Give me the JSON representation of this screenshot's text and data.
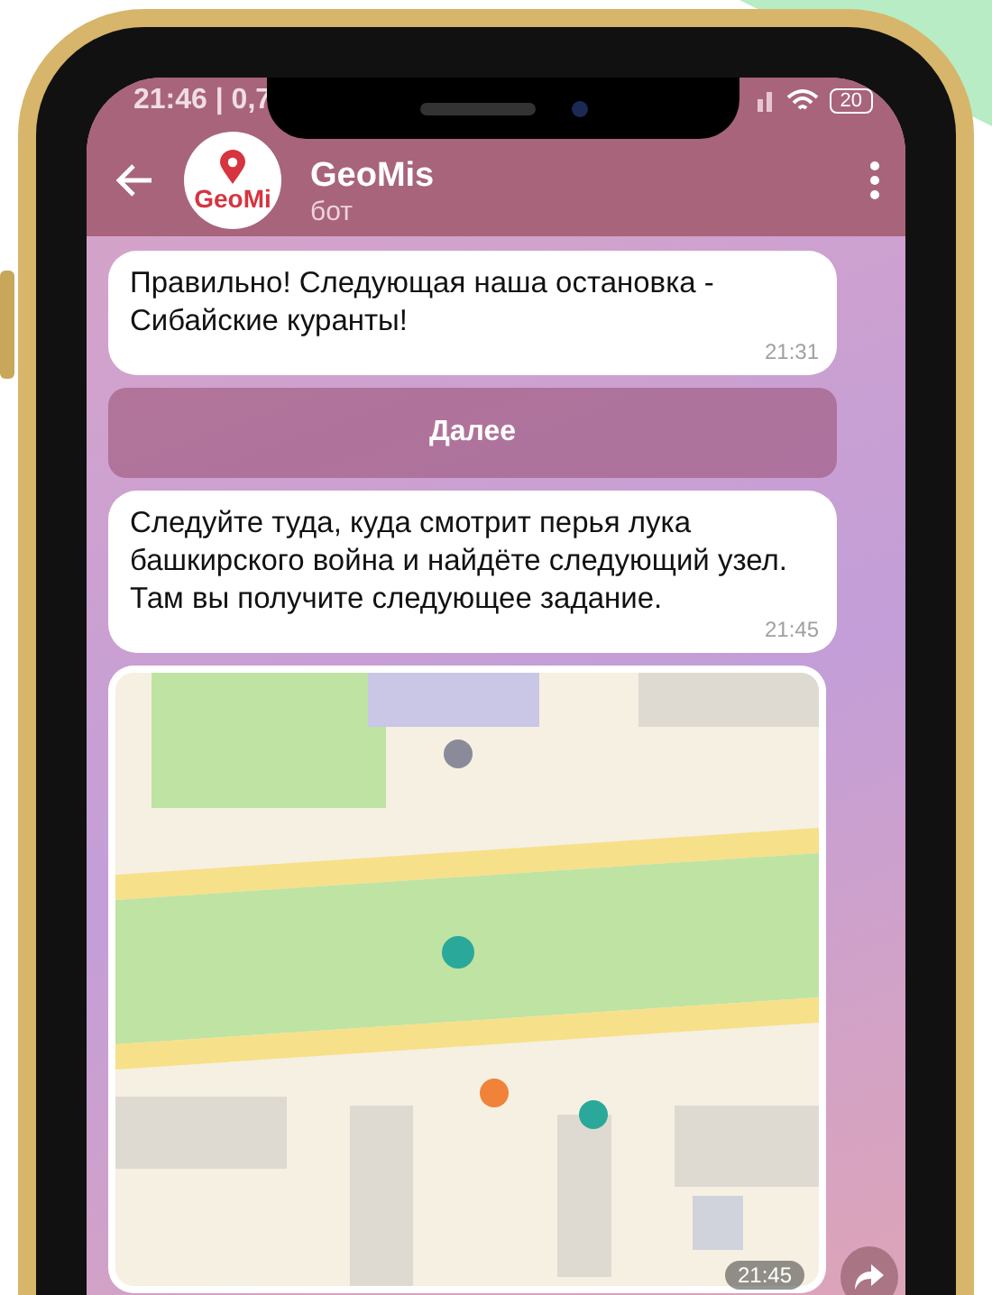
{
  "status_bar": {
    "time": "21:46 | 0,7",
    "battery": "20"
  },
  "header": {
    "title": "GeoMis",
    "subtitle": "бот",
    "avatar_text": "GeoMi"
  },
  "messages": [
    {
      "kind": "text",
      "text": "Правильно! Следующая наша остановка - Сибайские куранты!",
      "time": "21:31"
    },
    {
      "kind": "button",
      "label": "Далее"
    },
    {
      "kind": "text",
      "text": "Следуйте туда, куда смотрит перья лука башкирского война и найдёте следующий узел. Там вы получите следующее задание.",
      "time": "21:45"
    },
    {
      "kind": "map",
      "time": "21:45"
    }
  ]
}
